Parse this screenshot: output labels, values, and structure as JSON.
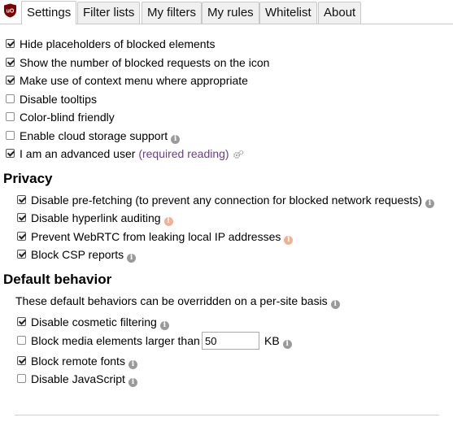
{
  "tabs": [
    {
      "label": "Settings",
      "active": true
    },
    {
      "label": "Filter lists",
      "active": false
    },
    {
      "label": "My filters",
      "active": false
    },
    {
      "label": "My rules",
      "active": false
    },
    {
      "label": "Whitelist",
      "active": false
    },
    {
      "label": "About",
      "active": false
    }
  ],
  "general": [
    {
      "label": "Hide placeholders of blocked elements",
      "checked": true
    },
    {
      "label": "Show the number of blocked requests on the icon",
      "checked": true
    },
    {
      "label": "Make use of context menu where appropriate",
      "checked": true
    },
    {
      "label": "Disable tooltips",
      "checked": false
    },
    {
      "label": "Color-blind friendly",
      "checked": false
    },
    {
      "label": "Enable cloud storage support",
      "checked": false,
      "info": "info-icon"
    },
    {
      "label": "I am an advanced user",
      "link": "(required reading)",
      "checked": true
    }
  ],
  "privacy": {
    "heading": "Privacy",
    "items": [
      {
        "label": "Disable pre-fetching (to prevent any connection for blocked network requests)",
        "checked": true
      },
      {
        "label": "Disable hyperlink auditing",
        "checked": true
      },
      {
        "label": "Prevent WebRTC from leaking local IP addresses",
        "checked": true
      },
      {
        "label": "Block CSP reports",
        "checked": true
      }
    ]
  },
  "default_behavior": {
    "heading": "Default behavior",
    "note": "These default behaviors can be overridden on a per-site basis",
    "items": [
      {
        "label": "Disable cosmetic filtering",
        "checked": true
      },
      {
        "label": "Block media elements larger than",
        "checked": false,
        "value": "50",
        "unit": "KB"
      },
      {
        "label": "Block remote fonts",
        "checked": true
      },
      {
        "label": "Disable JavaScript",
        "checked": false
      }
    ]
  },
  "colors": {
    "link": "#6a3d8f",
    "info_gray": "#9a9a9a",
    "info_orange": "#f3b08f",
    "logo_red": "#800000"
  }
}
